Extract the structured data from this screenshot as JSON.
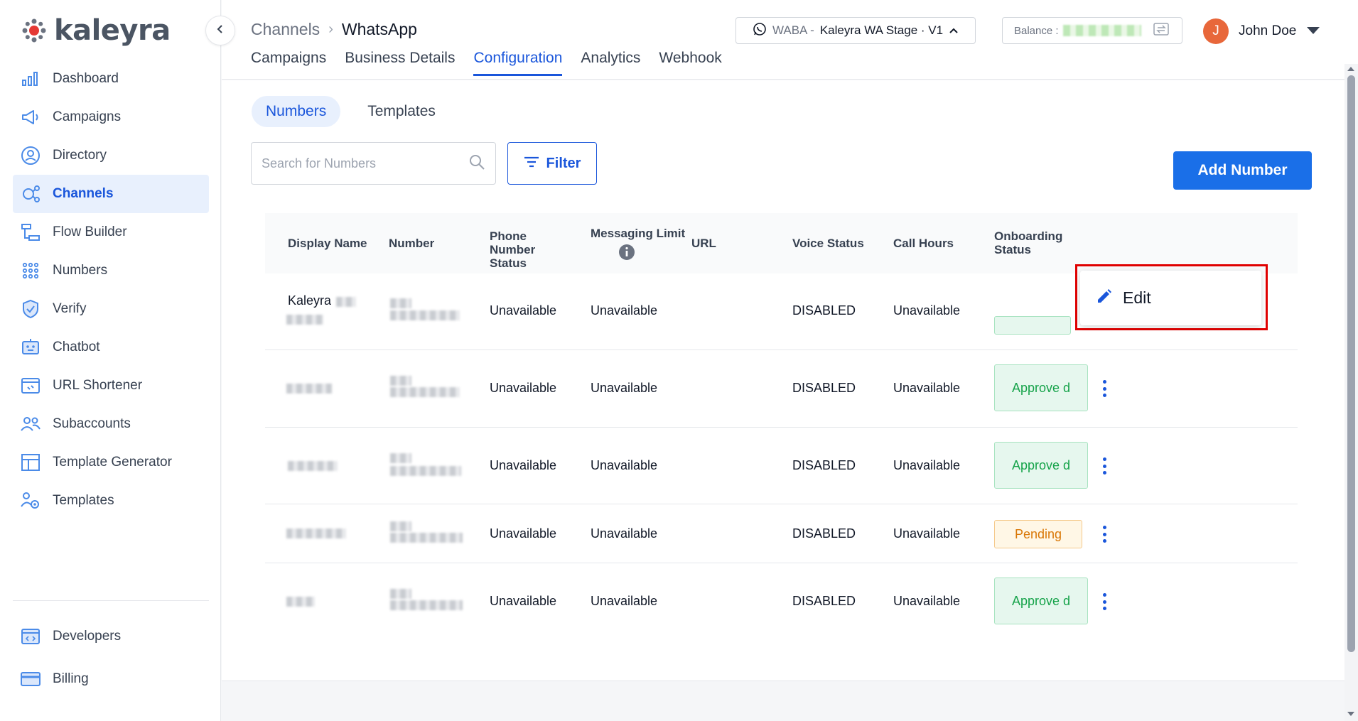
{
  "brand": {
    "name": "kaleyra"
  },
  "sidebar": {
    "items": [
      {
        "label": "Dashboard",
        "icon": "bar-chart-icon"
      },
      {
        "label": "Campaigns",
        "icon": "megaphone-icon"
      },
      {
        "label": "Directory",
        "icon": "contact-icon"
      },
      {
        "label": "Channels",
        "icon": "channels-icon",
        "active": true
      },
      {
        "label": "Flow Builder",
        "icon": "flow-icon"
      },
      {
        "label": "Numbers",
        "icon": "dialpad-icon"
      },
      {
        "label": "Verify",
        "icon": "shield-icon"
      },
      {
        "label": "Chatbot",
        "icon": "bot-icon"
      },
      {
        "label": "URL Shortener",
        "icon": "link-icon"
      },
      {
        "label": "Subaccounts",
        "icon": "users-icon"
      },
      {
        "label": "Template Generator",
        "icon": "layout-icon"
      },
      {
        "label": "Templates",
        "icon": "template-settings-icon"
      }
    ],
    "bottom": [
      {
        "label": "Developers",
        "icon": "code-icon"
      },
      {
        "label": "Billing",
        "icon": "card-icon"
      }
    ]
  },
  "header": {
    "breadcrumb_parent": "Channels",
    "breadcrumb_current": "WhatsApp",
    "tabs": [
      "Campaigns",
      "Business Details",
      "Configuration",
      "Analytics",
      "Webhook"
    ],
    "active_tab": "Configuration",
    "waba_label": "WABA -",
    "waba_name": "Kaleyra WA Stage · V1",
    "balance_label": "Balance :",
    "user_initial": "J",
    "user_name": "John Doe"
  },
  "main": {
    "subtabs": [
      "Numbers",
      "Templates"
    ],
    "search_placeholder": "Search for Numbers",
    "filter_label": "Filter",
    "add_button": "Add Number",
    "columns": [
      "Display Name",
      "Number",
      "Phone Number Status",
      "Messaging Limit",
      "URL",
      "Voice Status",
      "Call Hours",
      "Onboarding Status"
    ],
    "rows": [
      {
        "display_name": "Kaleyra",
        "phone_status": "Unavailable",
        "messaging_limit": "Unavailable",
        "url": "",
        "voice_status": "DISABLED",
        "call_hours": "Unavailable",
        "onboarding": ""
      },
      {
        "display_name": "",
        "phone_status": "Unavailable",
        "messaging_limit": "Unavailable",
        "url": "",
        "voice_status": "DISABLED",
        "call_hours": "Unavailable",
        "onboarding": "Approved",
        "onboarding_display": "Approve d"
      },
      {
        "display_name": "",
        "phone_status": "Unavailable",
        "messaging_limit": "Unavailable",
        "url": "",
        "voice_status": "DISABLED",
        "call_hours": "Unavailable",
        "onboarding": "Approved",
        "onboarding_display": "Approve d"
      },
      {
        "display_name": "",
        "phone_status": "Unavailable",
        "messaging_limit": "Unavailable",
        "url": "",
        "voice_status": "DISABLED",
        "call_hours": "Unavailable",
        "onboarding": "Pending",
        "onboarding_display": "Pending"
      },
      {
        "display_name": "",
        "phone_status": "Unavailable",
        "messaging_limit": "Unavailable",
        "url": "",
        "voice_status": "DISABLED",
        "call_hours": "Unavailable",
        "onboarding": "Approved",
        "onboarding_display": "Approve d"
      }
    ],
    "context_menu": {
      "edit_label": "Edit"
    }
  },
  "colors": {
    "accent": "#1a56db",
    "button": "#1a6fe8",
    "approved": "#16a34a",
    "pending": "#d97706",
    "highlight": "#e00000",
    "avatar": "#e8673a"
  }
}
